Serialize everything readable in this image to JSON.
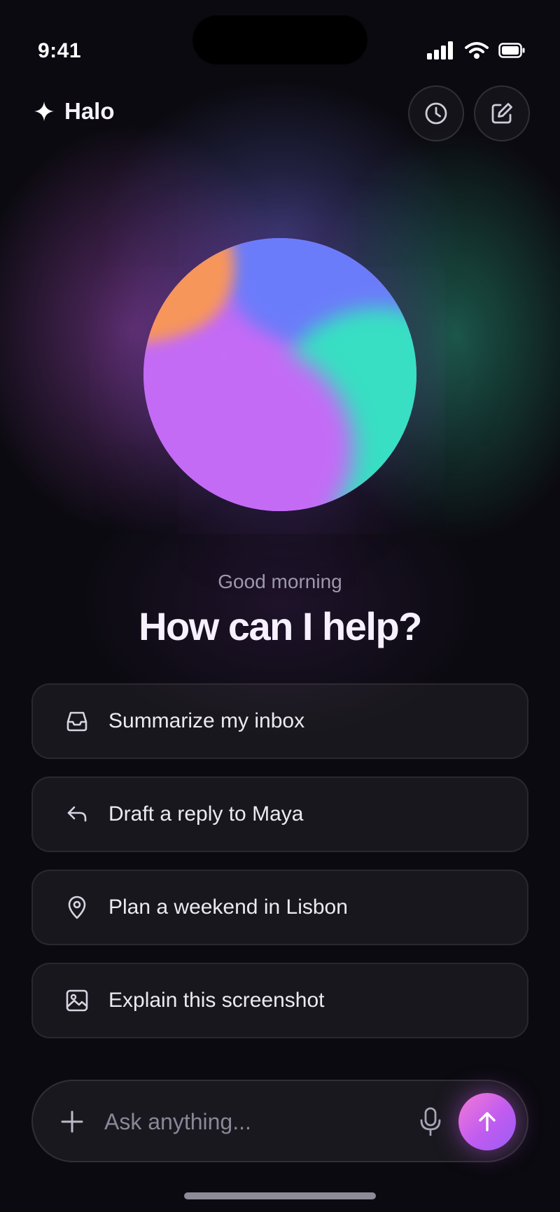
{
  "status_bar": {
    "time": "9:41",
    "icons": [
      "cellular-signal-icon",
      "wifi-icon",
      "battery-icon"
    ]
  },
  "header": {
    "app_name": "Halo",
    "logo_icon": "sparkle-icon",
    "actions": [
      {
        "name": "history",
        "icon": "clock-icon"
      },
      {
        "name": "new-chat",
        "icon": "compose-icon"
      }
    ]
  },
  "hero": {
    "greeting": "Good morning",
    "headline": "How can I help?"
  },
  "suggestions": [
    {
      "label": "Summarize my inbox",
      "icon": "inbox-icon"
    },
    {
      "label": "Draft a reply to Maya",
      "icon": "reply-icon"
    },
    {
      "label": "Plan a weekend in Lisbon",
      "icon": "location-pin-icon"
    },
    {
      "label": "Explain this screenshot",
      "icon": "image-icon"
    }
  ],
  "composer": {
    "placeholder": "Ask anything...",
    "value": "",
    "add_icon": "plus-icon",
    "mic_icon": "microphone-icon",
    "send_icon": "arrow-up-icon"
  },
  "colors": {
    "background": "#0b0a10",
    "accent_pink": "#f47ad6",
    "accent_purple": "#c05cf0",
    "orb_purple": "#c46bf6",
    "orb_blue": "#6b7cfa",
    "orb_teal": "#38dfc3",
    "orb_orange": "#f7965a"
  }
}
